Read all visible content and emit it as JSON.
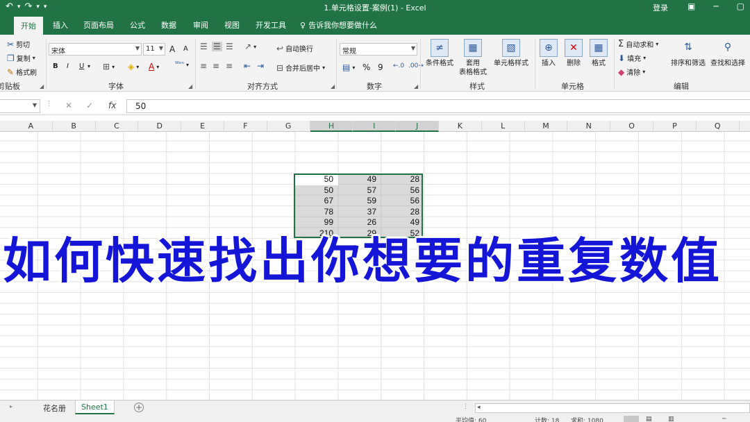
{
  "titlebar": {
    "title": "1.单元格设置-案例(1)  -  Excel",
    "login": "登录",
    "qat": {
      "undo": "↶",
      "undo_arrow": "▾",
      "redo": "↷",
      "redo_arrow": "▾",
      "customize": "▾"
    }
  },
  "tabs": [
    {
      "label": "开始",
      "active": true
    },
    {
      "label": "插入"
    },
    {
      "label": "页面布局"
    },
    {
      "label": "公式"
    },
    {
      "label": "数据"
    },
    {
      "label": "审阅"
    },
    {
      "label": "视图"
    },
    {
      "label": "开发工具"
    }
  ],
  "tell_me": "告诉我你想要做什么",
  "ribbon": {
    "clipboard": {
      "cut": "剪切",
      "copy": "复制",
      "format_painter": "格式刷",
      "label": "剪贴板"
    },
    "font": {
      "name": "宋体",
      "size": "11",
      "grow": "A",
      "shrink": "A",
      "bold": "B",
      "italic": "I",
      "underline": "U",
      "label": "字体"
    },
    "alignment": {
      "wrap": "自动换行",
      "merge": "合并后居中",
      "label": "对齐方式"
    },
    "number": {
      "format": "常规",
      "percent": "%",
      "comma": "9",
      "label": "数字"
    },
    "styles": {
      "conditional": "条件格式",
      "table_line1": "套用",
      "table_line2": "表格格式",
      "cell_styles": "单元格样式",
      "label": "样式"
    },
    "cells": {
      "insert": "插入",
      "delete": "删除",
      "format": "格式",
      "label": "单元格"
    },
    "editing": {
      "autosum": "自动求和",
      "fill": "填充",
      "clear": "清除",
      "sort": "排序和筛选",
      "find": "查找和选择",
      "label": "编辑"
    }
  },
  "formula_bar": {
    "value": "50",
    "fx": "fx",
    "cancel": "✕",
    "enter": "✓"
  },
  "columns": [
    "A",
    "B",
    "C",
    "D",
    "E",
    "F",
    "G",
    "H",
    "I",
    "J",
    "K",
    "L",
    "M",
    "N",
    "O",
    "P",
    "Q",
    "R"
  ],
  "selected_columns": [
    "H",
    "I",
    "J"
  ],
  "cells": [
    [
      "50",
      "49",
      "28"
    ],
    [
      "50",
      "57",
      "56"
    ],
    [
      "67",
      "59",
      "56"
    ],
    [
      "78",
      "37",
      "28"
    ],
    [
      "99",
      "26",
      "49"
    ],
    [
      "210",
      "29",
      "52"
    ]
  ],
  "banner": "如何快速找出你想要的重复数值",
  "sheets": [
    {
      "label": "花名册"
    },
    {
      "label": "Sheet1",
      "active": true
    }
  ],
  "add_sheet": "+",
  "status": {
    "average": "平均值: 60",
    "count": "计数: 18",
    "sum": "求和: 1080"
  },
  "colors": {
    "excel_green": "#217346",
    "banner_blue": "#1515d8"
  }
}
